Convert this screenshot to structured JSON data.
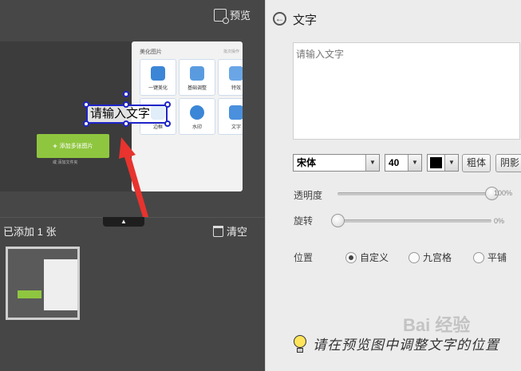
{
  "left": {
    "preview_label": "预览",
    "app_preview": {
      "header": "美化图片",
      "header_right": "批次操作",
      "tiles": [
        "一键美化",
        "基础调整",
        "特效",
        "文字",
        "水印",
        "文字"
      ],
      "tile_partial": "边框",
      "add_button": "添加多张图片",
      "add_folder": "或 添加文件夹"
    },
    "text_placeholder_overlay": "请输入文字",
    "added_count_label": "已添加 1 张",
    "clear_label": "清空",
    "collapse_glyph": "▲"
  },
  "panel": {
    "title": "文字",
    "back_glyph": "←",
    "text_placeholder": "请输入文字",
    "font_name": "宋体",
    "font_size": "40",
    "font_color": "#000000",
    "bold_label": "粗体",
    "shadow_label": "阴影",
    "opacity_label": "透明度",
    "opacity_value": "100%",
    "opacity_level": 1.0,
    "rotation_label": "旋转",
    "rotation_value": "0%",
    "rotation_level": 0.0,
    "position_label": "位置",
    "position_options": [
      "自定义",
      "九宫格",
      "平铺"
    ],
    "position_selected": "自定义",
    "tip": "请在预览图中调整文字的位置"
  },
  "watermark": "Bai 经验",
  "colors": {
    "accent_green": "#8fc63f",
    "selection_blue": "#1f24c8",
    "arrow_red": "#e8332e"
  }
}
